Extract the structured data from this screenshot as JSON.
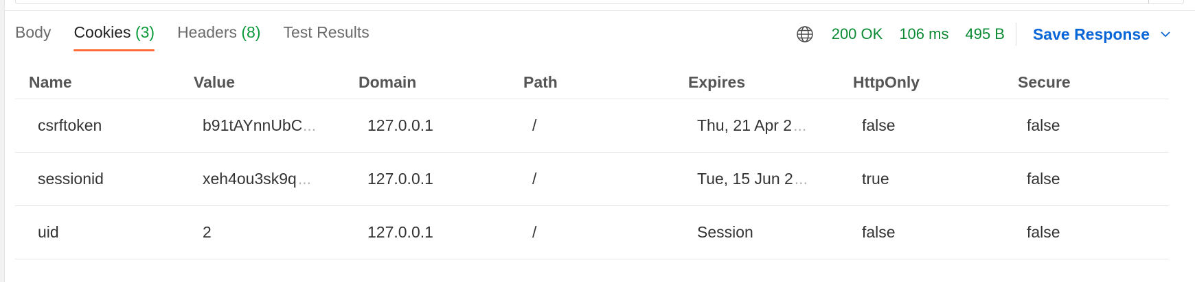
{
  "tabs": [
    {
      "label": "Body",
      "count": ""
    },
    {
      "label": "Cookies",
      "count": "(3)"
    },
    {
      "label": "Headers",
      "count": "(8)"
    },
    {
      "label": "Test Results",
      "count": ""
    }
  ],
  "active_tab": "Cookies",
  "status": {
    "code": "200 OK",
    "time": "106 ms",
    "size": "495 B",
    "icon": "globe-icon",
    "color": "#0b8a33"
  },
  "save_response": {
    "label": "Save Response",
    "icon": "chevron-down-icon",
    "color": "#0a66d6"
  },
  "accent_color": "#ff6c37",
  "cookies": {
    "columns": [
      "Name",
      "Value",
      "Domain",
      "Path",
      "Expires",
      "HttpOnly",
      "Secure"
    ],
    "rows": [
      {
        "name": "csrftoken",
        "value": "b91tAYnnUbC",
        "domain": "127.0.0.1",
        "path": "/",
        "expires": "Thu, 21 Apr 2",
        "httponly": "false",
        "secure": "false"
      },
      {
        "name": "sessionid",
        "value": "xeh4ou3sk9q",
        "domain": "127.0.0.1",
        "path": "/",
        "expires": "Tue, 15 Jun 2",
        "httponly": "true",
        "secure": "false"
      },
      {
        "name": "uid",
        "value": "2",
        "domain": "127.0.0.1",
        "path": "/",
        "expires": "Session",
        "httponly": "false",
        "secure": "false"
      }
    ],
    "truncation_marker": "..."
  }
}
